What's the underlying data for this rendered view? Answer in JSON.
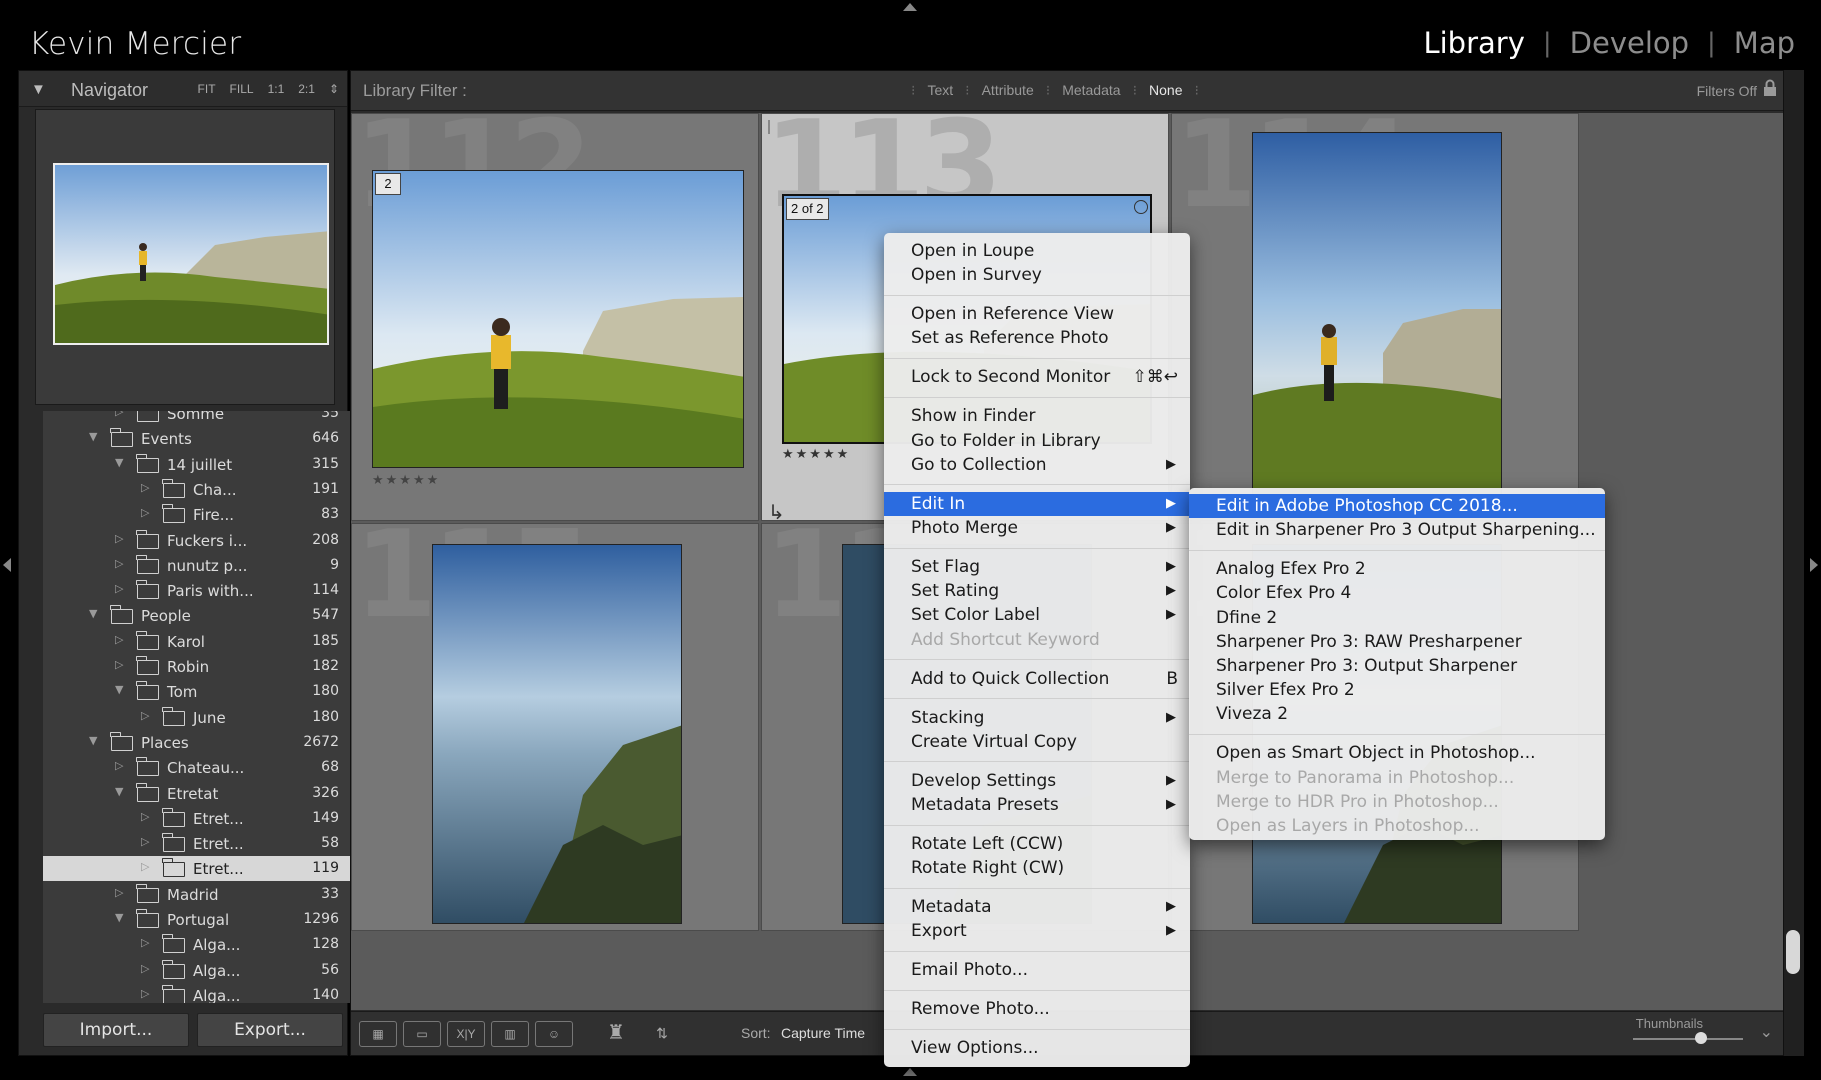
{
  "app": {
    "identity": "Kevin Mercier",
    "modules": [
      "Library",
      "Develop",
      "Map"
    ],
    "active_module": "Library"
  },
  "navigator": {
    "title": "Navigator",
    "zoom_options": [
      "FIT",
      "FILL",
      "1:1",
      "2:1"
    ]
  },
  "folders": [
    {
      "label": "Somme",
      "count": "35",
      "level": 1,
      "expanded": false
    },
    {
      "label": "Events",
      "count": "646",
      "level": 0,
      "expanded": true
    },
    {
      "label": "14 juillet",
      "count": "315",
      "level": 1,
      "expanded": true
    },
    {
      "label": "Cha...",
      "count": "191",
      "level": 2,
      "expanded": false
    },
    {
      "label": "Fire...",
      "count": "83",
      "level": 2,
      "expanded": false
    },
    {
      "label": "Fuckers i...",
      "count": "208",
      "level": 1,
      "expanded": false
    },
    {
      "label": "nunutz p...",
      "count": "9",
      "level": 1,
      "expanded": false
    },
    {
      "label": "Paris with...",
      "count": "114",
      "level": 1,
      "expanded": false
    },
    {
      "label": "People",
      "count": "547",
      "level": 0,
      "expanded": true
    },
    {
      "label": "Karol",
      "count": "185",
      "level": 1,
      "expanded": false
    },
    {
      "label": "Robin",
      "count": "182",
      "level": 1,
      "expanded": false
    },
    {
      "label": "Tom",
      "count": "180",
      "level": 1,
      "expanded": true
    },
    {
      "label": "June",
      "count": "180",
      "level": 2,
      "expanded": false
    },
    {
      "label": "Places",
      "count": "2672",
      "level": 0,
      "expanded": true
    },
    {
      "label": "Chateau...",
      "count": "68",
      "level": 1,
      "expanded": false
    },
    {
      "label": "Etretat",
      "count": "326",
      "level": 1,
      "expanded": true
    },
    {
      "label": "Etret...",
      "count": "149",
      "level": 2,
      "expanded": false
    },
    {
      "label": "Etret...",
      "count": "58",
      "level": 2,
      "expanded": false
    },
    {
      "label": "Etret...",
      "count": "119",
      "level": 2,
      "expanded": false,
      "selected": true
    },
    {
      "label": "Madrid",
      "count": "33",
      "level": 1,
      "expanded": false
    },
    {
      "label": "Portugal",
      "count": "1296",
      "level": 1,
      "expanded": true
    },
    {
      "label": "Alga...",
      "count": "128",
      "level": 2,
      "expanded": false
    },
    {
      "label": "Alga...",
      "count": "56",
      "level": 2,
      "expanded": false
    },
    {
      "label": "Alga...",
      "count": "140",
      "level": 2,
      "expanded": false
    }
  ],
  "buttons": {
    "import": "Import...",
    "export": "Export..."
  },
  "filter_bar": {
    "title": "Library Filter :",
    "options": [
      "Text",
      "Attribute",
      "Metadata",
      "None"
    ],
    "active": "None",
    "status": "Filters Off"
  },
  "grid": {
    "cells": [
      {
        "index": "112",
        "badge": "2",
        "selected": false
      },
      {
        "index": "113",
        "badge": "2 of 2",
        "selected": true
      },
      {
        "index": "114",
        "badge": "",
        "selected": false
      },
      {
        "index": "115",
        "badge": "",
        "selected": false
      },
      {
        "index": "116",
        "badge": "",
        "selected": false
      },
      {
        "index": "117",
        "badge": "",
        "selected": false
      }
    ],
    "rating_stars": "★★★★★"
  },
  "toolbar": {
    "sort_label": "Sort:",
    "sort_value": "Capture Time",
    "thumbnails_label": "Thumbnails",
    "thumbnails_level": 0.62
  },
  "context_menu": {
    "groups": [
      [
        {
          "label": "Open in Loupe"
        },
        {
          "label": "Open in Survey"
        }
      ],
      [
        {
          "label": "Open in Reference View"
        },
        {
          "label": "Set as Reference Photo"
        }
      ],
      [
        {
          "label": "Lock to Second Monitor",
          "shortcut": "⇧⌘↩"
        }
      ],
      [
        {
          "label": "Show in Finder"
        },
        {
          "label": "Go to Folder in Library"
        },
        {
          "label": "Go to Collection",
          "submenu": true
        }
      ],
      [
        {
          "label": "Edit In",
          "submenu": true,
          "highlighted": true
        },
        {
          "label": "Photo Merge",
          "submenu": true
        }
      ],
      [
        {
          "label": "Set Flag",
          "submenu": true
        },
        {
          "label": "Set Rating",
          "submenu": true
        },
        {
          "label": "Set Color Label",
          "submenu": true
        },
        {
          "label": "Add Shortcut Keyword",
          "disabled": true
        }
      ],
      [
        {
          "label": "Add to Quick Collection",
          "shortcut": "B"
        }
      ],
      [
        {
          "label": "Stacking",
          "submenu": true
        },
        {
          "label": "Create Virtual Copy"
        }
      ],
      [
        {
          "label": "Develop Settings",
          "submenu": true
        },
        {
          "label": "Metadata Presets",
          "submenu": true
        }
      ],
      [
        {
          "label": "Rotate Left (CCW)"
        },
        {
          "label": "Rotate Right (CW)"
        }
      ],
      [
        {
          "label": "Metadata",
          "submenu": true
        },
        {
          "label": "Export",
          "submenu": true
        }
      ],
      [
        {
          "label": "Email Photo..."
        }
      ],
      [
        {
          "label": "Remove Photo..."
        }
      ],
      [
        {
          "label": "View Options..."
        }
      ]
    ]
  },
  "submenu": {
    "groups": [
      [
        {
          "label": "Edit in Adobe Photoshop CC 2018...",
          "highlighted": true
        },
        {
          "label": "Edit in Sharpener Pro 3 Output Sharpening..."
        }
      ],
      [
        {
          "label": "Analog Efex Pro 2"
        },
        {
          "label": "Color Efex Pro 4"
        },
        {
          "label": "Dfine 2"
        },
        {
          "label": "Sharpener Pro 3: RAW Presharpener"
        },
        {
          "label": "Sharpener Pro 3: Output Sharpener"
        },
        {
          "label": "Silver Efex Pro 2"
        },
        {
          "label": "Viveza 2"
        }
      ],
      [
        {
          "label": "Open as Smart Object in Photoshop..."
        },
        {
          "label": "Merge to Panorama in Photoshop...",
          "disabled": true
        },
        {
          "label": "Merge to HDR Pro in Photoshop...",
          "disabled": true
        },
        {
          "label": "Open as Layers in Photoshop...",
          "disabled": true
        }
      ]
    ]
  },
  "colors": {
    "menu_highlight": "#2b6ce0",
    "selected_cell": "#c6c6c6",
    "panel_bg": "#3b3b3b"
  }
}
